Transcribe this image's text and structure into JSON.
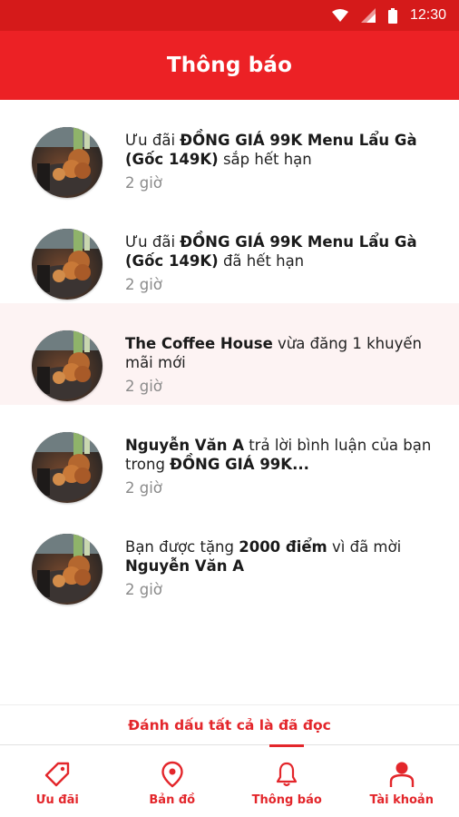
{
  "status_bar": {
    "time": "12:30"
  },
  "header": {
    "title": "Thông báo"
  },
  "notifications": [
    {
      "parts": [
        {
          "text": "Ưu đãi "
        },
        {
          "text": "ĐỒNG GIÁ 99K Menu Lẩu Gà (Gốc 149K)",
          "bold": true
        },
        {
          "text": " sắp hết hạn"
        }
      ],
      "time": "2 giờ",
      "unread": false
    },
    {
      "parts": [
        {
          "text": "Ưu đãi "
        },
        {
          "text": "ĐỒNG GIÁ 99K Menu Lẩu Gà (Gốc 149K)",
          "bold": true
        },
        {
          "text": " đã hết hạn"
        }
      ],
      "time": "2 giờ",
      "unread": false
    },
    {
      "parts": [
        {
          "text": "The Coffee House",
          "bold": true
        },
        {
          "text": " vừa đăng 1 khuyến mãi mới"
        }
      ],
      "time": "2 giờ",
      "unread": true
    },
    {
      "parts": [
        {
          "text": "Nguyễn Văn A",
          "bold": true
        },
        {
          "text": " trả lời bình luận của bạn trong "
        },
        {
          "text": "ĐỒNG GIÁ 99K...",
          "bold": true
        }
      ],
      "time": "2 giờ",
      "unread": false
    },
    {
      "parts": [
        {
          "text": "Bạn được tặng "
        },
        {
          "text": "2000 điểm",
          "bold": true
        },
        {
          "text": " vì đã mời "
        },
        {
          "text": "Nguyễn Văn A",
          "bold": true
        }
      ],
      "time": "2 giờ",
      "unread": false
    }
  ],
  "mark_all_read": "Đánh dấu tất cả là đã đọc",
  "bottom_nav": [
    {
      "label": "Ưu đãi",
      "icon": "tag-icon",
      "active": false
    },
    {
      "label": "Bản đồ",
      "icon": "map-pin-icon",
      "active": false
    },
    {
      "label": "Thông báo",
      "icon": "bell-icon",
      "active": true
    },
    {
      "label": "Tài khoản",
      "icon": "user-icon",
      "active": false
    }
  ],
  "colors": {
    "primary": "#ec2125",
    "status_bar": "#d51a1a",
    "unread_bg": "#fdf3f3",
    "time_text": "#8a8a8a"
  }
}
